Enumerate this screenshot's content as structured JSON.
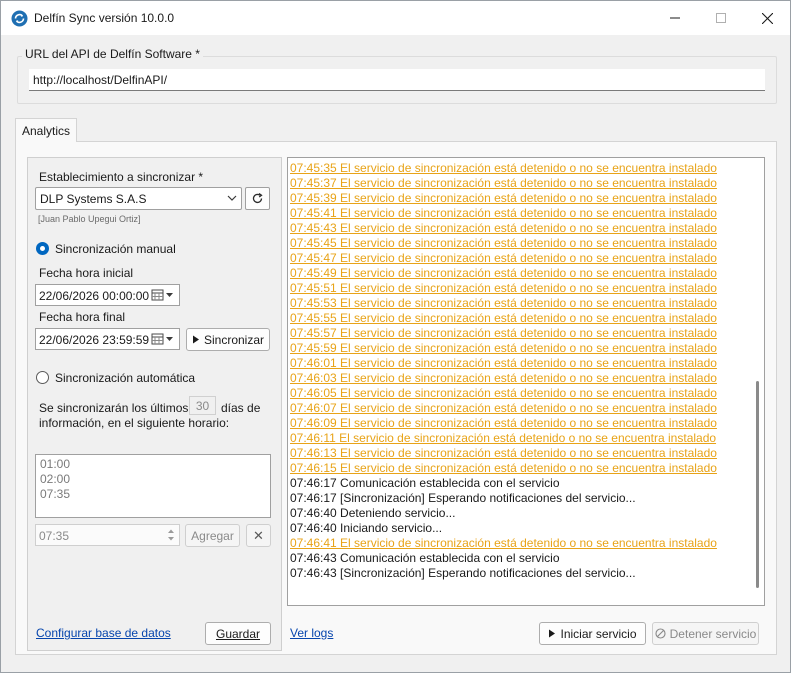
{
  "window": {
    "title": "Delfín Sync versión 10.0.0",
    "accent_color": "#0067c0"
  },
  "url_group": {
    "label": "URL del API de Delfín Software *",
    "value": "http://localhost/DelfinAPI/"
  },
  "tabs": [
    {
      "label": "Analytics"
    }
  ],
  "left": {
    "establishment_label": "Establecimiento a sincronizar *",
    "establishment_value": "DLP Systems S.A.S",
    "user_hint": "[Juan Pablo Upegui Ortiz]",
    "manual_label": "Sincronización manual",
    "manual_selected": true,
    "start_label": "Fecha hora inicial",
    "start_value": "22/06/2026 00:00:00",
    "end_label": "Fecha hora final",
    "end_value": "22/06/2026 23:59:59",
    "sync_button": "Sincronizar",
    "auto_label": "Sincronización automática",
    "days_text_1": "Se sincronizarán los últimos",
    "days_value": "30",
    "days_text_2": "días de",
    "days_text_3": "información, en el siguiente horario:",
    "schedule": [
      "01:00",
      "02:00",
      "07:35"
    ],
    "time_value": "07:35",
    "add_button": "Agregar",
    "remove_button": "✕",
    "config_link": "Configurar base de datos",
    "save_button": "Guardar"
  },
  "bottom": {
    "logs_link": "Ver logs",
    "start_button": "Iniciar servicio",
    "stop_button": "Detener servicio"
  },
  "log": {
    "warn_color": "#e8a317",
    "lines": [
      {
        "text": "07:45:35 El servicio de sincronización está detenido o no se encuentra instalado",
        "kind": "warn"
      },
      {
        "text": "07:45:37 El servicio de sincronización está detenido o no se encuentra instalado",
        "kind": "warn"
      },
      {
        "text": "07:45:39 El servicio de sincronización está detenido o no se encuentra instalado",
        "kind": "warn"
      },
      {
        "text": "07:45:41 El servicio de sincronización está detenido o no se encuentra instalado",
        "kind": "warn"
      },
      {
        "text": "07:45:43 El servicio de sincronización está detenido o no se encuentra instalado",
        "kind": "warn"
      },
      {
        "text": "07:45:45 El servicio de sincronización está detenido o no se encuentra instalado",
        "kind": "warn"
      },
      {
        "text": "07:45:47 El servicio de sincronización está detenido o no se encuentra instalado",
        "kind": "warn"
      },
      {
        "text": "07:45:49 El servicio de sincronización está detenido o no se encuentra instalado",
        "kind": "warn"
      },
      {
        "text": "07:45:51 El servicio de sincronización está detenido o no se encuentra instalado",
        "kind": "warn"
      },
      {
        "text": "07:45:53 El servicio de sincronización está detenido o no se encuentra instalado",
        "kind": "warn"
      },
      {
        "text": "07:45:55 El servicio de sincronización está detenido o no se encuentra instalado",
        "kind": "warn"
      },
      {
        "text": "07:45:57 El servicio de sincronización está detenido o no se encuentra instalado",
        "kind": "warn"
      },
      {
        "text": "07:45:59 El servicio de sincronización está detenido o no se encuentra instalado",
        "kind": "warn"
      },
      {
        "text": "07:46:01 El servicio de sincronización está detenido o no se encuentra instalado",
        "kind": "warn"
      },
      {
        "text": "07:46:03 El servicio de sincronización está detenido o no se encuentra instalado",
        "kind": "warn"
      },
      {
        "text": "07:46:05 El servicio de sincronización está detenido o no se encuentra instalado",
        "kind": "warn"
      },
      {
        "text": "07:46:07 El servicio de sincronización está detenido o no se encuentra instalado",
        "kind": "warn"
      },
      {
        "text": "07:46:09 El servicio de sincronización está detenido o no se encuentra instalado",
        "kind": "warn"
      },
      {
        "text": "07:46:11 El servicio de sincronización está detenido o no se encuentra instalado",
        "kind": "warn"
      },
      {
        "text": "07:46:13 El servicio de sincronización está detenido o no se encuentra instalado",
        "kind": "warn"
      },
      {
        "text": "07:46:15 El servicio de sincronización está detenido o no se encuentra instalado",
        "kind": "warn"
      },
      {
        "text": "07:46:17 Comunicación establecida con el servicio",
        "kind": "info"
      },
      {
        "text": "07:46:17 [Sincronización] Esperando notificaciones del servicio...",
        "kind": "info"
      },
      {
        "text": "07:46:40 Deteniendo servicio...",
        "kind": "info"
      },
      {
        "text": "07:46:40 Iniciando servicio...",
        "kind": "info"
      },
      {
        "text": "07:46:41 El servicio de sincronización está detenido o no se encuentra instalado",
        "kind": "warn"
      },
      {
        "text": "07:46:43 Comunicación establecida con el servicio",
        "kind": "info"
      },
      {
        "text": "07:46:43 [Sincronización] Esperando notificaciones del servicio...",
        "kind": "info"
      }
    ]
  }
}
